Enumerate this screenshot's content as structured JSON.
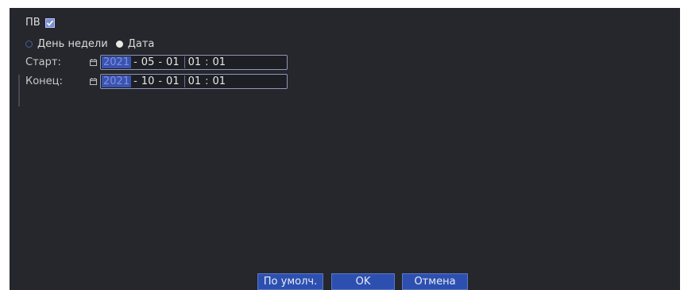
{
  "dst": {
    "label": "ПВ",
    "checked": true
  },
  "mode": {
    "options": [
      {
        "label": "День недели",
        "selected": false
      },
      {
        "label": "Дата",
        "selected": true
      }
    ]
  },
  "start": {
    "label": "Старт:",
    "year": "2021",
    "month": "05",
    "day": "01",
    "hour": "01",
    "minute": "01"
  },
  "end": {
    "label": "Конец:",
    "year": "2021",
    "month": "10",
    "day": "01",
    "hour": "01",
    "minute": "01"
  },
  "buttons": {
    "default_label": "По умолч.",
    "ok_label": "OK",
    "cancel_label": "Отмена"
  },
  "colors": {
    "background": "#25272c",
    "accent": "#2d50b0",
    "year_highlight": "#3b53b0"
  }
}
